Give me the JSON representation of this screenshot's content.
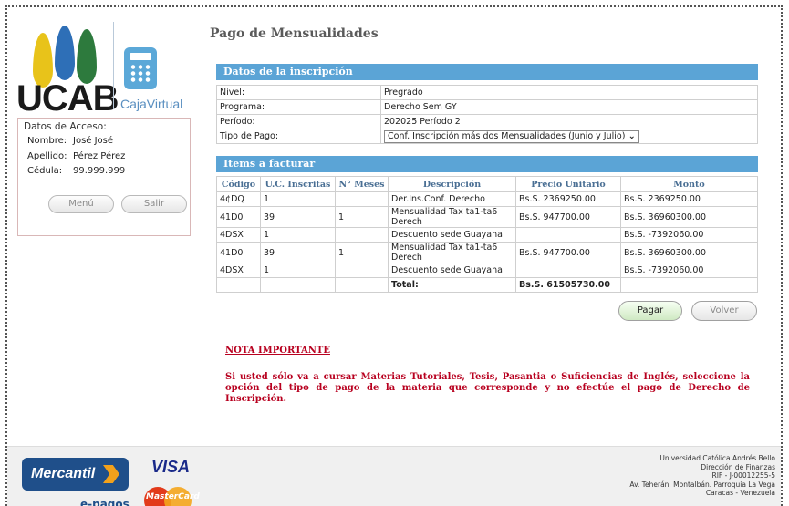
{
  "brand": {
    "name": "UCAB",
    "product": "CajaVirtual"
  },
  "access": {
    "title": "Datos de Acceso:",
    "nombre_label": "Nombre:",
    "nombre": "José José",
    "apellido_label": "Apellido:",
    "apellido": "Pérez Pérez",
    "cedula_label": "Cédula:",
    "cedula": "99.999.999",
    "menu_button": "Menú",
    "salir_button": "Salir"
  },
  "page": {
    "title": "Pago de Mensualidades"
  },
  "inscripcion": {
    "header": "Datos de la inscripción",
    "rows": [
      {
        "label": "Nivel:",
        "value": "Pregrado"
      },
      {
        "label": "Programa:",
        "value": "Derecho Sem GY"
      },
      {
        "label": "Período:",
        "value": "202025 Período 2"
      }
    ],
    "tipo_pago_label": "Tipo de Pago:",
    "tipo_pago_selected": "Conf. Inscripción más dos Mensualidades (Junio y Julio)"
  },
  "items": {
    "header": "Items a facturar",
    "columns": [
      "Código",
      "U.C. Inscritas",
      "N° Meses",
      "Descripción",
      "Precio Unitario",
      "Monto"
    ],
    "rows": [
      [
        "4¢DQ",
        "1",
        "",
        "Der.Ins.Conf. Derecho",
        "Bs.S. 2369250.00",
        "Bs.S. 2369250.00"
      ],
      [
        "41D0",
        "39",
        "1",
        "Mensualidad Tax ta1-ta6 Derech",
        "Bs.S. 947700.00",
        "Bs.S. 36960300.00"
      ],
      [
        "4DSX",
        "1",
        "",
        "Descuento sede Guayana",
        "",
        "Bs.S. -7392060.00"
      ],
      [
        "41D0",
        "39",
        "1",
        "Mensualidad Tax ta1-ta6 Derech",
        "Bs.S. 947700.00",
        "Bs.S. 36960300.00"
      ],
      [
        "4DSX",
        "1",
        "",
        "Descuento sede Guayana",
        "",
        "Bs.S. -7392060.00"
      ]
    ],
    "total_label": "Total:",
    "total_value": "Bs.S. 61505730.00"
  },
  "actions": {
    "pagar": "Pagar",
    "volver": "Volver"
  },
  "nota": {
    "title": "NOTA IMPORTANTE",
    "body": "Si usted sólo va a cursar Materias Tutoriales, Tesis, Pasantia o Suficiencias de Inglés, seleccione la opción del tipo de pago de la materia que corresponde y no efectúe el pago de Derecho de Inscripción."
  },
  "footer": {
    "bank": "Mercantil",
    "epagos": "e-pagos",
    "visa": "VISA",
    "mastercard": "MasterCard",
    "address": [
      "Universidad Católica Andrés Bello",
      "Dirección de Finanzas",
      "RIF - J-00012255-5",
      "Av. Teherán, Montalbán. Parroquia La Vega",
      "Caracas - Venezuela"
    ]
  }
}
